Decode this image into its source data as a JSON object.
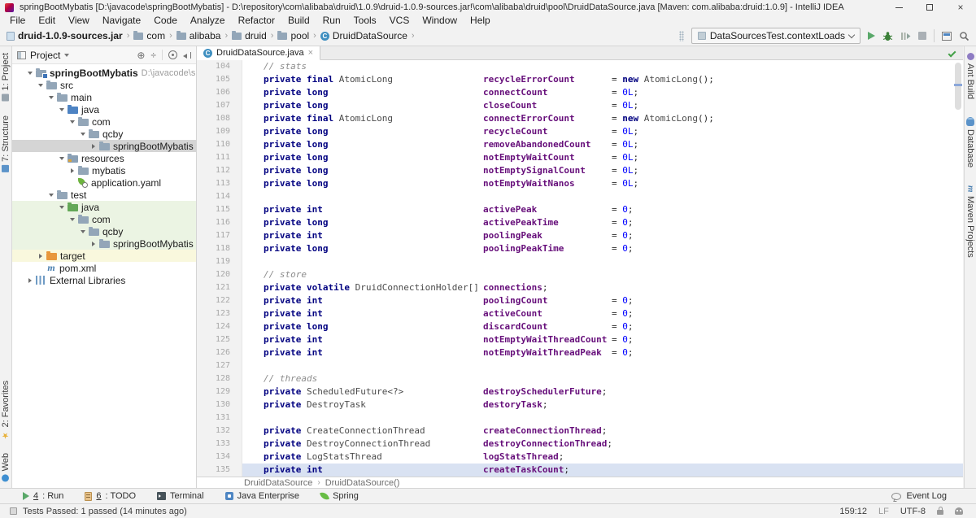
{
  "title_bar": {
    "title": "springBootMybatis [D:\\javacode\\springBootMybatis] - D:\\repository\\com\\alibaba\\druid\\1.0.9\\druid-1.0.9-sources.jar!\\com\\alibaba\\druid\\pool\\DruidDataSource.java [Maven: com.alibaba:druid:1.0.9] - IntelliJ IDEA"
  },
  "menu_bar": {
    "items": [
      "File",
      "Edit",
      "View",
      "Navigate",
      "Code",
      "Analyze",
      "Refactor",
      "Build",
      "Run",
      "Tools",
      "VCS",
      "Window",
      "Help"
    ]
  },
  "nav_bar": {
    "crumbs": [
      {
        "icon": "jar",
        "label": "druid-1.0.9-sources.jar",
        "bold": true
      },
      {
        "icon": "folder",
        "label": "com"
      },
      {
        "icon": "folder",
        "label": "alibaba"
      },
      {
        "icon": "folder",
        "label": "druid"
      },
      {
        "icon": "folder",
        "label": "pool"
      },
      {
        "icon": "class",
        "label": "DruidDataSource"
      }
    ],
    "run_config": "DataSourcesTest.contextLoads"
  },
  "left_stripe": {
    "top": [
      "1: Project",
      "7: Structure"
    ],
    "bottom": [
      "2: Favorites",
      "Web"
    ]
  },
  "right_stripe": {
    "items": [
      "Ant Build",
      "Database",
      "Maven Projects"
    ]
  },
  "project_panel": {
    "header": "Project",
    "tree": [
      {
        "lvl": 0,
        "chev": "open",
        "icon": "project-folder",
        "label": "springBootMybatis",
        "extra": "D:\\javacode\\springB",
        "bold": true
      },
      {
        "lvl": 1,
        "chev": "open",
        "icon": "folder",
        "label": "src"
      },
      {
        "lvl": 2,
        "chev": "open",
        "icon": "folder",
        "label": "main"
      },
      {
        "lvl": 3,
        "chev": "open",
        "icon": "source-folder",
        "label": "java"
      },
      {
        "lvl": 4,
        "chev": "open",
        "icon": "folder",
        "label": "com"
      },
      {
        "lvl": 5,
        "chev": "open",
        "icon": "folder",
        "label": "qcby"
      },
      {
        "lvl": 6,
        "chev": "closed",
        "icon": "folder",
        "label": "springBootMybatis",
        "sel": true
      },
      {
        "lvl": 3,
        "chev": "open",
        "icon": "resources-folder",
        "label": "resources"
      },
      {
        "lvl": 4,
        "chev": "closed",
        "icon": "folder",
        "label": "mybatis"
      },
      {
        "lvl": 4,
        "icon": "yaml-file",
        "label": "application.yaml"
      },
      {
        "lvl": 2,
        "chev": "open",
        "icon": "folder",
        "label": "test"
      },
      {
        "lvl": 3,
        "chev": "open",
        "icon": "test-folder",
        "label": "java",
        "bg": "green"
      },
      {
        "lvl": 4,
        "chev": "open",
        "icon": "folder",
        "label": "com",
        "bg": "green"
      },
      {
        "lvl": 5,
        "chev": "open",
        "icon": "folder",
        "label": "qcby",
        "bg": "green"
      },
      {
        "lvl": 6,
        "chev": "closed",
        "icon": "folder",
        "label": "springBootMybatis",
        "bg": "green"
      },
      {
        "lvl": 1,
        "chev": "closed",
        "icon": "excluded-folder",
        "label": "target",
        "bg": "yellow"
      },
      {
        "lvl": 1,
        "icon": "maven-file",
        "label": "pom.xml"
      },
      {
        "lvl": 0,
        "chev": "closed",
        "icon": "libraries",
        "label": "External Libraries"
      }
    ]
  },
  "editor": {
    "tab": "DruidDataSource.java",
    "breadcrumbs": [
      "DruidDataSource",
      "DruidDataSource()"
    ],
    "lines": [
      {
        "n": 104,
        "comment": "// stats"
      },
      {
        "n": 105,
        "type": [
          [
            "k",
            "private"
          ],
          [
            "p",
            " "
          ],
          [
            "k",
            "final"
          ],
          [
            "t",
            " AtomicLong"
          ]
        ],
        "name": "recycleErrorCount",
        "value": [
          [
            "p",
            "= "
          ],
          [
            "k",
            "new"
          ],
          [
            "t",
            " AtomicLong"
          ],
          [
            "p",
            "();"
          ]
        ]
      },
      {
        "n": 106,
        "type": [
          [
            "k",
            "private"
          ],
          [
            "p",
            " "
          ],
          [
            "k",
            "long"
          ]
        ],
        "name": "connectCount",
        "value": [
          [
            "p",
            "= "
          ],
          [
            "n",
            "0L"
          ],
          [
            "p",
            ";"
          ]
        ]
      },
      {
        "n": 107,
        "type": [
          [
            "k",
            "private"
          ],
          [
            "p",
            " "
          ],
          [
            "k",
            "long"
          ]
        ],
        "name": "closeCount",
        "value": [
          [
            "p",
            "= "
          ],
          [
            "n",
            "0L"
          ],
          [
            "p",
            ";"
          ]
        ]
      },
      {
        "n": 108,
        "type": [
          [
            "k",
            "private"
          ],
          [
            "p",
            " "
          ],
          [
            "k",
            "final"
          ],
          [
            "t",
            " AtomicLong"
          ]
        ],
        "name": "connectErrorCount",
        "value": [
          [
            "p",
            "= "
          ],
          [
            "k",
            "new"
          ],
          [
            "t",
            " AtomicLong"
          ],
          [
            "p",
            "();"
          ]
        ]
      },
      {
        "n": 109,
        "type": [
          [
            "k",
            "private"
          ],
          [
            "p",
            " "
          ],
          [
            "k",
            "long"
          ]
        ],
        "name": "recycleCount",
        "value": [
          [
            "p",
            "= "
          ],
          [
            "n",
            "0L"
          ],
          [
            "p",
            ";"
          ]
        ]
      },
      {
        "n": 110,
        "type": [
          [
            "k",
            "private"
          ],
          [
            "p",
            " "
          ],
          [
            "k",
            "long"
          ]
        ],
        "name": "removeAbandonedCount",
        "value": [
          [
            "p",
            "= "
          ],
          [
            "n",
            "0L"
          ],
          [
            "p",
            ";"
          ]
        ]
      },
      {
        "n": 111,
        "type": [
          [
            "k",
            "private"
          ],
          [
            "p",
            " "
          ],
          [
            "k",
            "long"
          ]
        ],
        "name": "notEmptyWaitCount",
        "value": [
          [
            "p",
            "= "
          ],
          [
            "n",
            "0L"
          ],
          [
            "p",
            ";"
          ]
        ]
      },
      {
        "n": 112,
        "type": [
          [
            "k",
            "private"
          ],
          [
            "p",
            " "
          ],
          [
            "k",
            "long"
          ]
        ],
        "name": "notEmptySignalCount",
        "value": [
          [
            "p",
            "= "
          ],
          [
            "n",
            "0L"
          ],
          [
            "p",
            ";"
          ]
        ]
      },
      {
        "n": 113,
        "type": [
          [
            "k",
            "private"
          ],
          [
            "p",
            " "
          ],
          [
            "k",
            "long"
          ]
        ],
        "name": "notEmptyWaitNanos",
        "value": [
          [
            "p",
            "= "
          ],
          [
            "n",
            "0L"
          ],
          [
            "p",
            ";"
          ]
        ]
      },
      {
        "n": 114
      },
      {
        "n": 115,
        "type": [
          [
            "k",
            "private"
          ],
          [
            "p",
            " "
          ],
          [
            "k",
            "int"
          ]
        ],
        "name": "activePeak",
        "value": [
          [
            "p",
            "= "
          ],
          [
            "n",
            "0"
          ],
          [
            "p",
            ";"
          ]
        ]
      },
      {
        "n": 116,
        "type": [
          [
            "k",
            "private"
          ],
          [
            "p",
            " "
          ],
          [
            "k",
            "long"
          ]
        ],
        "name": "activePeakTime",
        "value": [
          [
            "p",
            "= "
          ],
          [
            "n",
            "0"
          ],
          [
            "p",
            ";"
          ]
        ]
      },
      {
        "n": 117,
        "type": [
          [
            "k",
            "private"
          ],
          [
            "p",
            " "
          ],
          [
            "k",
            "int"
          ]
        ],
        "name": "poolingPeak",
        "value": [
          [
            "p",
            "= "
          ],
          [
            "n",
            "0"
          ],
          [
            "p",
            ";"
          ]
        ]
      },
      {
        "n": 118,
        "type": [
          [
            "k",
            "private"
          ],
          [
            "p",
            " "
          ],
          [
            "k",
            "long"
          ]
        ],
        "name": "poolingPeakTime",
        "value": [
          [
            "p",
            "= "
          ],
          [
            "n",
            "0"
          ],
          [
            "p",
            ";"
          ]
        ]
      },
      {
        "n": 119
      },
      {
        "n": 120,
        "comment": "// store"
      },
      {
        "n": 121,
        "type": [
          [
            "k",
            "private"
          ],
          [
            "p",
            " "
          ],
          [
            "k",
            "volatile"
          ],
          [
            "t",
            " DruidConnectionHolder[]"
          ]
        ],
        "name": "connections",
        "suffix": ";"
      },
      {
        "n": 122,
        "type": [
          [
            "k",
            "private"
          ],
          [
            "p",
            " "
          ],
          [
            "k",
            "int"
          ]
        ],
        "name": "poolingCount",
        "value": [
          [
            "p",
            "= "
          ],
          [
            "n",
            "0"
          ],
          [
            "p",
            ";"
          ]
        ]
      },
      {
        "n": 123,
        "type": [
          [
            "k",
            "private"
          ],
          [
            "p",
            " "
          ],
          [
            "k",
            "int"
          ]
        ],
        "name": "activeCount",
        "value": [
          [
            "p",
            "= "
          ],
          [
            "n",
            "0"
          ],
          [
            "p",
            ";"
          ]
        ]
      },
      {
        "n": 124,
        "type": [
          [
            "k",
            "private"
          ],
          [
            "p",
            " "
          ],
          [
            "k",
            "long"
          ]
        ],
        "name": "discardCount",
        "value": [
          [
            "p",
            "= "
          ],
          [
            "n",
            "0"
          ],
          [
            "p",
            ";"
          ]
        ]
      },
      {
        "n": 125,
        "type": [
          [
            "k",
            "private"
          ],
          [
            "p",
            " "
          ],
          [
            "k",
            "int"
          ]
        ],
        "name": "notEmptyWaitThreadCount",
        "value": [
          [
            "p",
            "= "
          ],
          [
            "n",
            "0"
          ],
          [
            "p",
            ";"
          ]
        ]
      },
      {
        "n": 126,
        "type": [
          [
            "k",
            "private"
          ],
          [
            "p",
            " "
          ],
          [
            "k",
            "int"
          ]
        ],
        "name": "notEmptyWaitThreadPeak",
        "value": [
          [
            "p",
            "= "
          ],
          [
            "n",
            "0"
          ],
          [
            "p",
            ";"
          ]
        ]
      },
      {
        "n": 127
      },
      {
        "n": 128,
        "comment": "// threads"
      },
      {
        "n": 129,
        "type": [
          [
            "k",
            "private"
          ],
          [
            "t",
            " ScheduledFuture<?>"
          ]
        ],
        "name": "destroySchedulerFuture",
        "suffix": ";"
      },
      {
        "n": 130,
        "type": [
          [
            "k",
            "private"
          ],
          [
            "t",
            " DestroyTask"
          ]
        ],
        "name": "destoryTask",
        "suffix": ";"
      },
      {
        "n": 131
      },
      {
        "n": 132,
        "type": [
          [
            "k",
            "private"
          ],
          [
            "t",
            " CreateConnectionThread"
          ]
        ],
        "name": "createConnectionThread",
        "suffix": ";"
      },
      {
        "n": 133,
        "type": [
          [
            "k",
            "private"
          ],
          [
            "t",
            " DestroyConnectionThread"
          ]
        ],
        "name": "destroyConnectionThread",
        "suffix": ";"
      },
      {
        "n": 134,
        "type": [
          [
            "k",
            "private"
          ],
          [
            "t",
            " LogStatsThread"
          ]
        ],
        "name": "logStatsThread",
        "suffix": ";"
      },
      {
        "n": 135,
        "type": [
          [
            "k",
            "private"
          ],
          [
            "p",
            " "
          ],
          [
            "k",
            "int"
          ]
        ],
        "name": "createTaskCount",
        "suffix": ";",
        "hl": true
      }
    ]
  },
  "bottom_bar": {
    "items": [
      {
        "icon": "run",
        "mnemonic": "4",
        "label": ": Run"
      },
      {
        "icon": "todo",
        "mnemonic": "6",
        "label": ": TODO"
      },
      {
        "icon": "terminal",
        "label": "Terminal"
      },
      {
        "icon": "java-enterprise",
        "label": "Java Enterprise"
      },
      {
        "icon": "spring",
        "label": "Spring"
      }
    ],
    "event_log": "Event Log"
  },
  "status_bar": {
    "message": "Tests Passed: 1 passed (14 minutes ago)",
    "position": "159:12",
    "line_separator": "LF",
    "encoding": "UTF-8"
  },
  "colors": {
    "keyword": "#000080",
    "field": "#660e7a",
    "number": "#0000ff",
    "comment": "#8c8c8c",
    "test_scope_bg": "#ebf4e3",
    "excluded_bg": "#f9f8dd",
    "accent_green": "#59a869"
  }
}
